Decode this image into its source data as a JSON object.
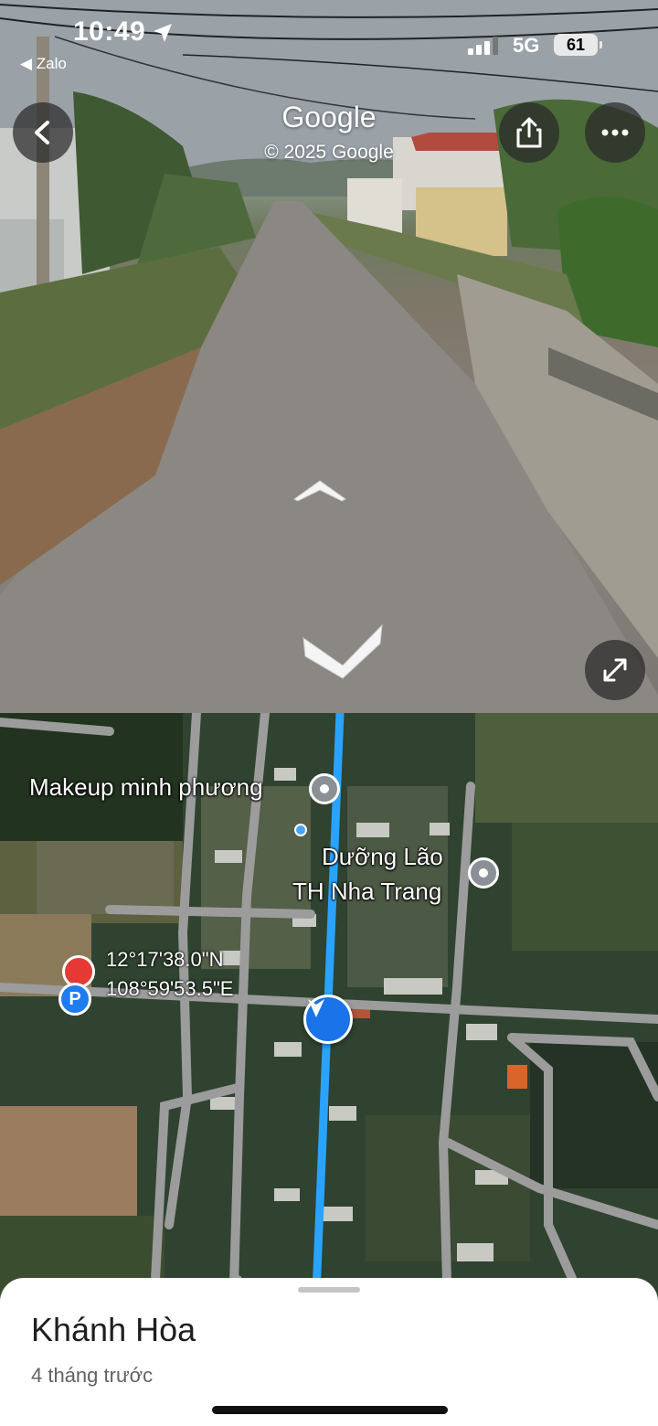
{
  "status_bar": {
    "time": "10:49",
    "back_app": "Zalo",
    "network": "5G",
    "battery": "61"
  },
  "street_view": {
    "logo": "Google",
    "copyright": "© 2025 Google",
    "icons": {
      "back": "chevron-left-icon",
      "share": "share-icon",
      "more": "more-horizontal-icon",
      "forward_arrow": "chevron-up-icon",
      "backward_arrow": "chevron-down-icon",
      "expand": "expand-diagonal-icon"
    }
  },
  "map": {
    "poi_1": "Makeup minh phương",
    "poi_2_line1": "Dưỡng Lão",
    "poi_2_line2": "TH Nha Trang",
    "lat": "12°17'38.0\"N",
    "lng": "108°59'53.5\"E",
    "parking_label": "P",
    "colors": {
      "route": "#29a3ff",
      "road": "#9a9a9a",
      "marker": "#1a73e8"
    }
  },
  "sheet": {
    "place": "Khánh Hòa",
    "time_ago": "4 tháng trước"
  }
}
